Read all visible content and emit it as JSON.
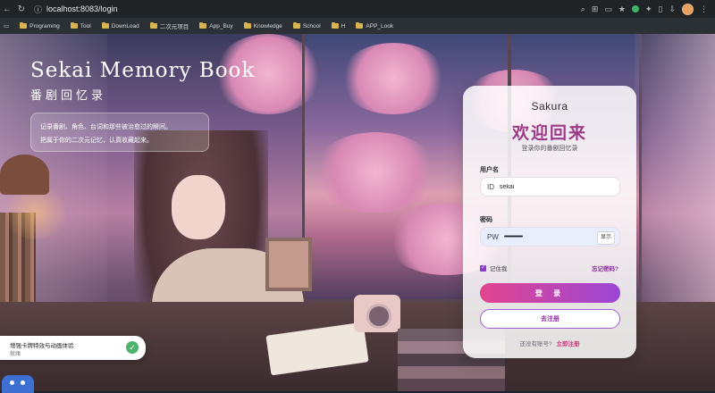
{
  "browser": {
    "url": "localhost:8083/login",
    "bookmarks": [
      "Programing",
      "Tool",
      "DownLoad",
      "二次元项目",
      "App_Buy",
      "Knowledge",
      "School",
      "H",
      "APP_Look"
    ]
  },
  "hero": {
    "title": "Sekai Memory Book",
    "subtitle": "番剧回忆录",
    "desc_line1": "记录番剧、角色、台词和那些被治愈过的瞬间。",
    "desc_line2": "把属于你的二次元记忆，认真收藏起来。"
  },
  "login": {
    "brand": "Sakura",
    "welcome": "欢迎回来",
    "welcome_sub": "登录你的番剧回忆录",
    "username_label": "用户名",
    "username_prefix": "ID",
    "username_value": "sekai",
    "password_label": "密码",
    "password_prefix": "PW",
    "password_value": "••••••••••••••",
    "show_label": "显示",
    "remember_label": "记住我",
    "remember_checked": true,
    "forgot_label": "忘记密码?",
    "login_button": "登 录",
    "register_button": "去注册",
    "no_account_text": "还没有账号?",
    "register_link": "立即注册"
  },
  "toast": {
    "title": "增强卡牌特效与动画体验",
    "status": "就绪"
  },
  "colors": {
    "accent": "#9c3a86",
    "button_gradient_start": "#e3458e",
    "button_gradient_end": "#9a47d6"
  }
}
